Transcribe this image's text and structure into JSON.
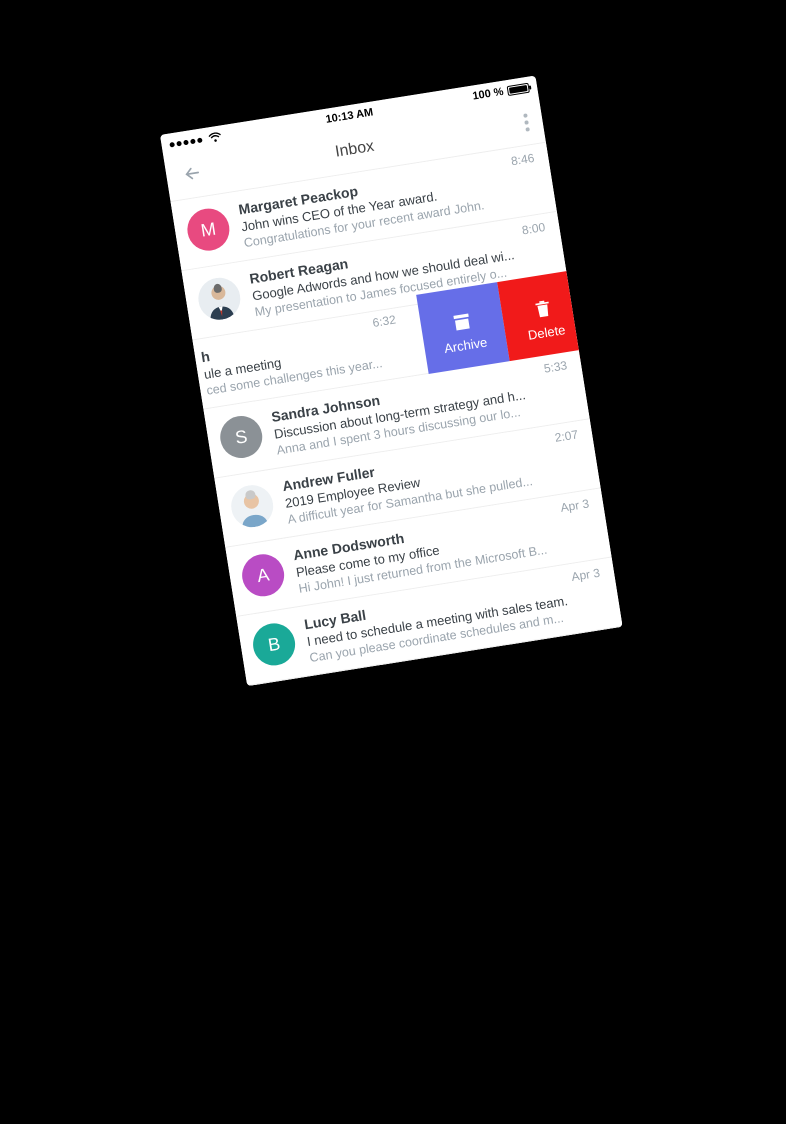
{
  "statusbar": {
    "time": "10:13 AM",
    "battery_pct": "100 %"
  },
  "toolbar": {
    "title": "Inbox"
  },
  "swipe_actions": {
    "archive": "Archive",
    "delete": "Delete"
  },
  "messages": [
    {
      "sender": "Margaret Peackop",
      "subject": "John wins CEO of the Year award.",
      "snippet": "Congratulations for your recent award John.",
      "time": "8:46",
      "avatar": {
        "type": "letter",
        "letter": "M",
        "color": "#e84a80"
      }
    },
    {
      "sender": "Robert Reagan",
      "subject": "Google Adwords and how we should deal wi...",
      "snippet": "My presentation to James focused entirely o...",
      "time": "8:00",
      "avatar": {
        "type": "photo-man-suit"
      }
    },
    {
      "sender": "h",
      "subject": "ule a meeting",
      "snippet": "ced some challenges this year...",
      "time": "6:32",
      "swiped": true
    },
    {
      "sender": "Sandra Johnson",
      "subject": "Discussion about long-term strategy and h...",
      "snippet": "Anna and I spent 3 hours discussing our lo...",
      "time": "5:33",
      "avatar": {
        "type": "letter",
        "letter": "S",
        "color": "#8b9196"
      }
    },
    {
      "sender": "Andrew Fuller",
      "subject": "2019 Employee Review",
      "snippet": "A difficult year for Samantha but she pulled...",
      "time": "2:07",
      "avatar": {
        "type": "photo-man-casual"
      }
    },
    {
      "sender": "Anne Dodsworth",
      "subject": "Please come to my office",
      "snippet": "Hi John! I just returned from the Microsoft B...",
      "time": "Apr 3",
      "avatar": {
        "type": "letter",
        "letter": "A",
        "color": "#b94cc4"
      }
    },
    {
      "sender": "Lucy Ball",
      "subject": "I need to schedule a meeting with sales team.",
      "snippet": "Can you please coordinate schedules and m...",
      "time": "Apr 3",
      "avatar": {
        "type": "letter",
        "letter": "B",
        "color": "#1aa998"
      }
    }
  ]
}
